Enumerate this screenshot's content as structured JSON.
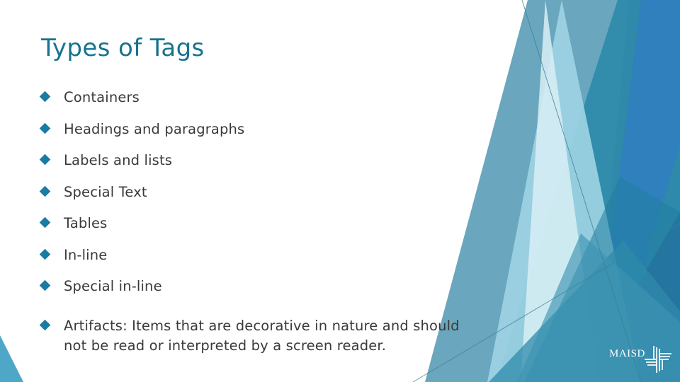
{
  "slide": {
    "title": "Types of Tags",
    "background_color": "#ffffff",
    "title_color": "#17738f",
    "bullet_color": "#1a7ca3",
    "body_text_color": "#3a3a3a"
  },
  "bullets": [
    {
      "text": "Containers"
    },
    {
      "text": "Headings and paragraphs"
    },
    {
      "text": "Labels and lists"
    },
    {
      "text": "Special Text"
    },
    {
      "text": "Tables"
    },
    {
      "text": "In-line"
    },
    {
      "text": "Special in-line"
    },
    {
      "text": "Artifacts: Items that are decorative in nature and should",
      "line2": "not be read or interpreted by a screen reader."
    }
  ],
  "logo": {
    "wordmark": "MAISD",
    "mark_name": "woven-grid-mark"
  },
  "decor": {
    "palette": {
      "deep_blue": "#2a6b9e",
      "bright_blue": "#2f7fbf",
      "dark_teal": "#1f7ea0",
      "mid_teal": "#2f8bab",
      "steel_teal": "#6aa6bd",
      "slate_teal": "#5e9cb4",
      "light_teal": "#74b8ce",
      "pale_blue": "#9fd4e3",
      "very_pale": "#cfe9f2",
      "hairline": "#3e7f93"
    }
  }
}
